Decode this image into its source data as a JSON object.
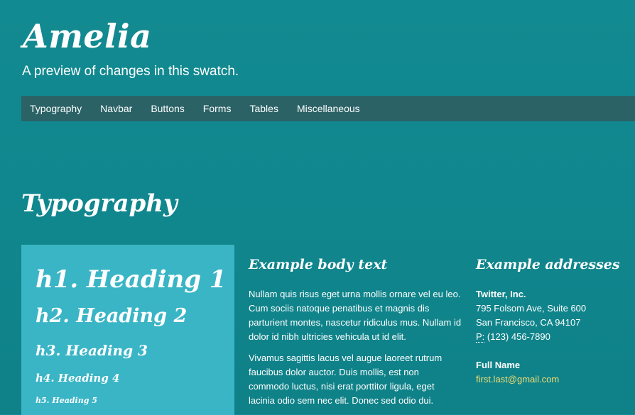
{
  "brand": {
    "title": "Amelia",
    "tagline": "A preview of changes in this swatch."
  },
  "navbar": {
    "items": [
      "Typography",
      "Navbar",
      "Buttons",
      "Forms",
      "Tables",
      "Miscellaneous"
    ]
  },
  "section": {
    "title": "Typography"
  },
  "headings": [
    "h1. Heading 1",
    "h2. Heading 2",
    "h3. Heading 3",
    "h4. Heading 4",
    "h5. Heading 5"
  ],
  "body_text": {
    "title": "Example body text",
    "paragraphs": [
      "Nullam quis risus eget urna mollis ornare vel eu leo. Cum sociis natoque penatibus et magnis dis parturient montes, nascetur ridiculus mus. Nullam id dolor id nibh ultricies vehicula ut id elit.",
      "Vivamus sagittis lacus vel augue laoreet rutrum faucibus dolor auctor. Duis mollis, est non commodo luctus, nisi erat porttitor ligula, eget lacinia odio sem nec elit. Donec sed odio dui."
    ]
  },
  "addresses": {
    "title": "Example addresses",
    "company": {
      "name": "Twitter, Inc.",
      "street": "795 Folsom Ave, Suite 600",
      "city": "San Francisco, CA 94107",
      "phone_abbr": "P:",
      "phone": " (123) 456-7890"
    },
    "person": {
      "name": "Full Name",
      "email": "first.last@gmail.com"
    }
  },
  "colors": {
    "background": "#10868d",
    "navbar": "#2a6266",
    "heading_panel": "#3ab5c6",
    "link": "#f3dc72"
  }
}
